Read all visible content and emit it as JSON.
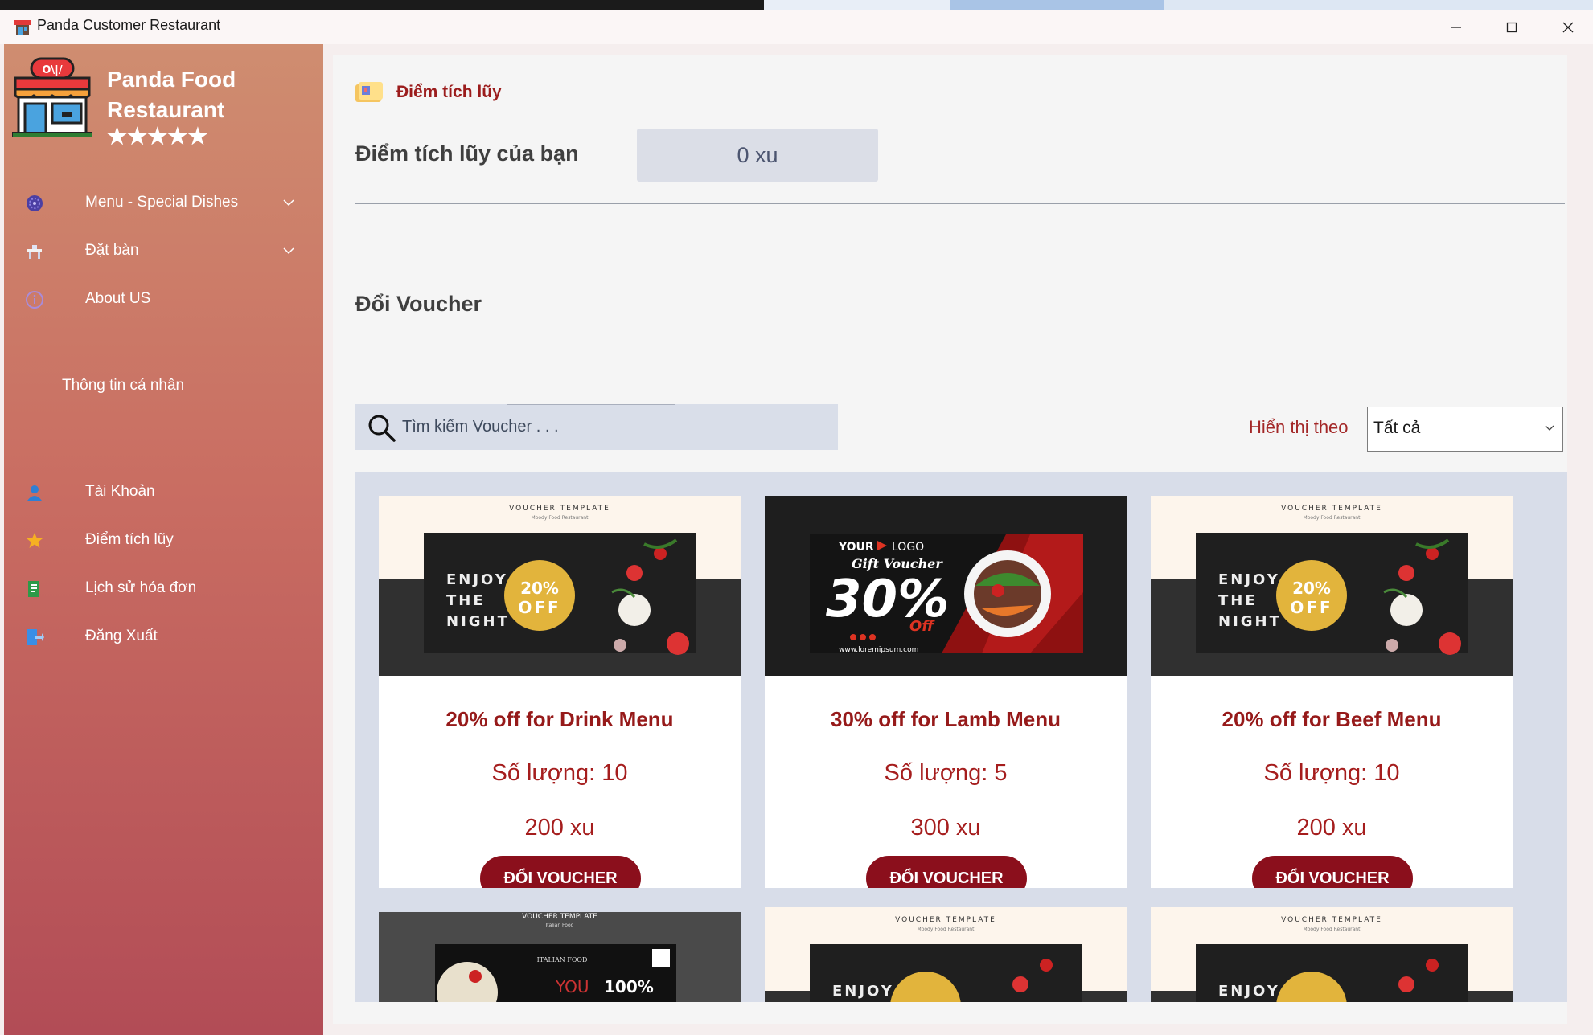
{
  "window": {
    "title": "Panda Customer Restaurant"
  },
  "brand": {
    "line1": "Panda Food",
    "line2": "Restaurant ★★★★★"
  },
  "nav": {
    "menu": "Menu - Special Dishes",
    "booking": "Đặt bàn",
    "about": "About US",
    "section_personal": "Thông tin cá nhân",
    "account": "Tài Khoản",
    "points": "Điểm tích lũy",
    "history": "Lịch sử hóa đơn",
    "logout": "Đăng Xuất"
  },
  "page": {
    "header": "Điểm tích lũy",
    "points_label": "Điểm tích lũy của bạn",
    "points_value": "0 xu",
    "voucher_header": "Đổi Voucher"
  },
  "search": {
    "placeholder": "Tìm kiếm Voucher . . ."
  },
  "filter": {
    "label": "Hiển thị theo",
    "selected": "Tất cả"
  },
  "vouchers": [
    {
      "title": "20% off for Drink Menu",
      "quantity": "Số lượng: 10",
      "price": "200 xu",
      "button": "ĐỔI VOUCHER"
    },
    {
      "title": "30% off for Lamb Menu",
      "quantity": "Số lượng: 5",
      "price": "300 xu",
      "button": "ĐỔI VOUCHER"
    },
    {
      "title": "20% off for Beef Menu",
      "quantity": "Số lượng: 10",
      "price": "200 xu",
      "button": "ĐỔI VOUCHER"
    }
  ],
  "voucher_art": {
    "template_caption": "VOUCHER TEMPLATE",
    "template_sub": "Moody Food Restaurant",
    "enjoy": [
      "ENJOY",
      "THE",
      "NIGHT"
    ],
    "percent": "20%",
    "off": "OFF",
    "your": "YOUR",
    "logo": "LOGO",
    "gift": "Gift Voucher",
    "big_percent": "30%",
    "big_off": "Off",
    "site": "www.loremipsum.com",
    "italian": "ITALIAN FOOD",
    "you": "YOU",
    "hundred": "100%",
    "italian_caption": "VOUCHER TEMPLATE",
    "italian_sub": "Italian Food",
    "enjoy_partial": "ENJOY"
  },
  "colors": {
    "accent": "#961a1a",
    "button": "#8b0f1c",
    "sidebar_top": "#cf8d70",
    "sidebar_bottom": "#b24c56",
    "voucher_gold": "#e2b43c",
    "voucher_dark": "#2c2c2c"
  },
  "icons": {
    "menu": "flower-plate-icon",
    "booking": "table-icon",
    "about": "info-icon",
    "account": "user-icon",
    "points": "star-icon",
    "history": "receipt-icon",
    "logout": "logout-icon"
  }
}
